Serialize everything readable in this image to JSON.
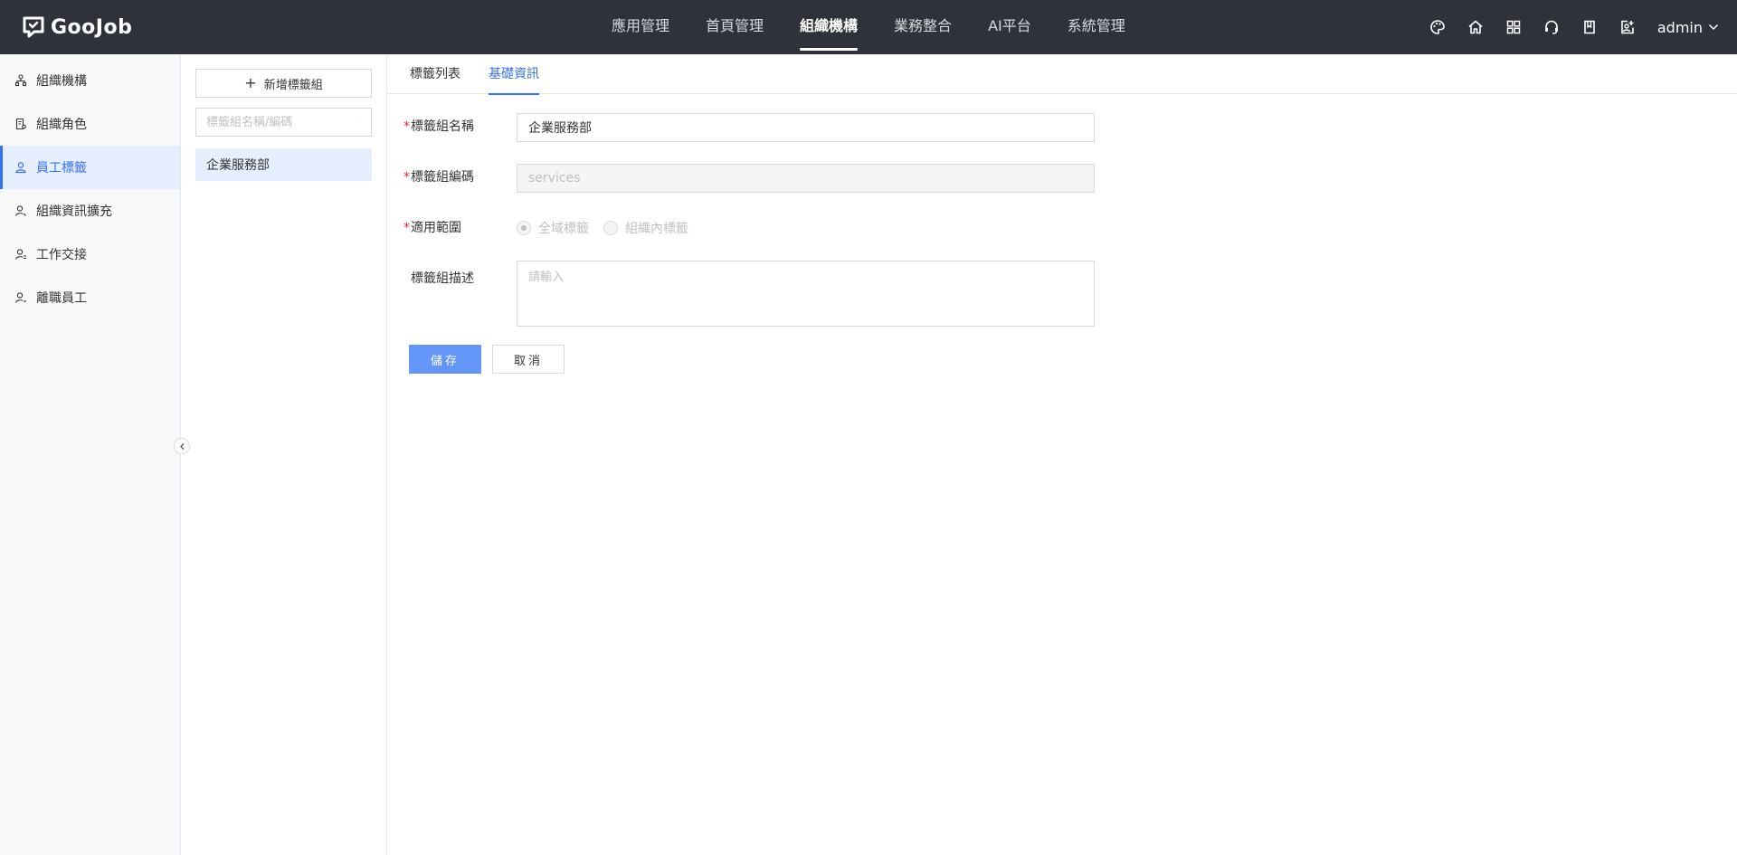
{
  "brand": {
    "name": "GooJob"
  },
  "topnav": [
    {
      "label": "應用管理",
      "active": false
    },
    {
      "label": "首頁管理",
      "active": false
    },
    {
      "label": "組織機構",
      "active": true
    },
    {
      "label": "業務整合",
      "active": false
    },
    {
      "label": "AI平台",
      "active": false
    },
    {
      "label": "系統管理",
      "active": false
    }
  ],
  "user": {
    "name": "admin"
  },
  "sidebar": {
    "items": [
      {
        "label": "組織機構",
        "icon": "org-tree-icon"
      },
      {
        "label": "組織角色",
        "icon": "role-doc-icon"
      },
      {
        "label": "員工標籤",
        "icon": "user-tag-icon",
        "active": true
      },
      {
        "label": "組織資訊擴充",
        "icon": "user-edit-icon"
      },
      {
        "label": "工作交接",
        "icon": "user-transfer-icon"
      },
      {
        "label": "離職員工",
        "icon": "user-leave-icon"
      }
    ]
  },
  "groups": {
    "add_label": "新增標籤組",
    "search_placeholder": "標籤組名稱/編碼",
    "items": [
      {
        "label": "企業服務部",
        "selected": true
      }
    ]
  },
  "tabs": [
    {
      "label": "標籤列表",
      "active": false
    },
    {
      "label": "基礎資訊",
      "active": true
    }
  ],
  "form": {
    "name": {
      "label": "標籤組名稱",
      "value": "企業服務部",
      "required": true
    },
    "code": {
      "label": "標籤組編碼",
      "value": "services",
      "required": true
    },
    "scope": {
      "label": "適用範圍",
      "required": true,
      "options": [
        {
          "label": "全域標籤",
          "checked": true
        },
        {
          "label": "組織內標籤",
          "checked": false
        }
      ]
    },
    "desc": {
      "label": "標籤組描述",
      "placeholder": "請輸入"
    },
    "save_label": "儲存",
    "cancel_label": "取消"
  }
}
